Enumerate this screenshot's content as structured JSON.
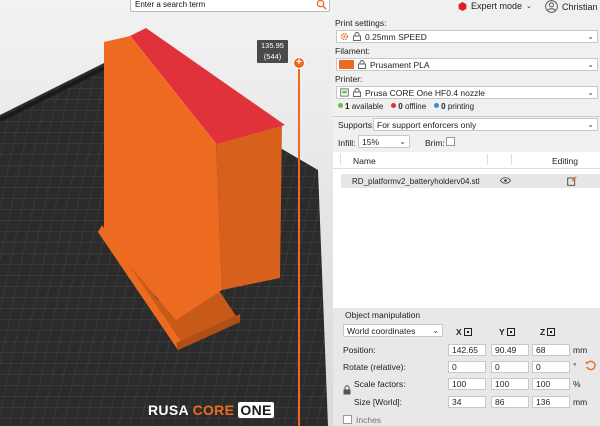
{
  "search": {
    "placeholder": "Enter a search term",
    "icon": "search-icon"
  },
  "topbar": {
    "mode_label": "Expert mode",
    "mode_color": "#e02020",
    "user_name": "Christian"
  },
  "viewport": {
    "z_label_line1": "135.95",
    "z_label_line2": "(544)",
    "bed_logo_part1": "RUSA",
    "bed_logo_part2": "CORE",
    "bed_logo_part3": "ONE",
    "model_color": "#ed6b21",
    "top_face_color": "#e0323a"
  },
  "panel": {
    "print_settings": {
      "label": "Print settings:",
      "value": "0.25mm SPEED"
    },
    "filament": {
      "label": "Filament:",
      "value": "Prusament PLA",
      "color": "#ed6b21"
    },
    "printer": {
      "label": "Printer:",
      "value": "Prusa CORE One HF0.4 nozzle"
    },
    "status": {
      "available": {
        "count": "1",
        "text": "available",
        "color": "#6cc04a"
      },
      "offline": {
        "count": "0",
        "text": "offline",
        "color": "#e0323a"
      },
      "printing": {
        "count": "0",
        "text": "printing",
        "color": "#3a8fd8"
      }
    },
    "supports": {
      "label": "Supports:",
      "value": "For support enforcers only"
    },
    "infill": {
      "label": "Infill:",
      "value": "15%"
    },
    "brim": {
      "label": "Brim:",
      "checked": false
    },
    "objects": {
      "col_name": "Name",
      "col_editing": "Editing",
      "rows": [
        {
          "name": "RD_platformv2_batteryholderv04.stl"
        }
      ]
    },
    "object_manipulation": {
      "title": "Object manipulation",
      "coord_system": "World coordinates",
      "axes": [
        "X",
        "Y",
        "Z"
      ],
      "position": {
        "label": "Position:",
        "x": "142.65",
        "y": "90.49",
        "z": "68",
        "unit": "mm"
      },
      "rotate": {
        "label": "Rotate (relative):",
        "x": "0",
        "y": "0",
        "z": "0",
        "unit": "°"
      },
      "scale": {
        "label": "Scale factors:",
        "x": "100",
        "y": "100",
        "z": "100",
        "unit": "%"
      },
      "size": {
        "label": "Size [World]:",
        "x": "34",
        "y": "86",
        "z": "136",
        "unit": "mm"
      },
      "inches": {
        "label": "Inches",
        "checked": false
      }
    }
  }
}
